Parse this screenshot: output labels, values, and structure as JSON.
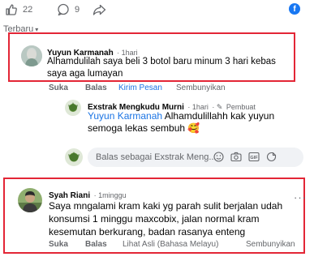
{
  "reactions": {
    "like_count": "22",
    "comment_count": "9"
  },
  "sort": {
    "label": "Terbaru"
  },
  "comments": [
    {
      "author": "Yuyun Karmanah",
      "time": "1hari",
      "text": "Alhamdulilah saya beli 3 botol baru minum 3 hari kebas saya aga lumayan",
      "actions": [
        "Suka",
        "Balas",
        "Kirim Pesan",
        "Sembunyikan"
      ]
    },
    {
      "author": "Syah Riani",
      "time": "1minggu",
      "text": "Saya mngalami kram kaki yg parah sulit berjalan udah konsumsi 1 minggu maxcobix, jalan normal kram kesemutan berkurang, badan rasanya enteng",
      "actions": [
        "Suka",
        "Balas",
        "Lihat Asli (Bahasa Melayu)",
        "Sembunyikan"
      ]
    }
  ],
  "reply": {
    "author": "Exstrak Mengkudu Murni",
    "time": "1hari",
    "author_badge": "Pembuat",
    "mention": "Yuyun Karmanah",
    "text": " Alhamdulillahh kak yuyun semoga lekas sembuh",
    "emoji": "🥰"
  },
  "reply_input": {
    "placeholder": "Balas sebagai Exstrak Meng..."
  },
  "colors": {
    "highlight": "#e32636",
    "link": "#1b74e4",
    "bubble": "#f0f2f5",
    "muted": "#65676b"
  }
}
